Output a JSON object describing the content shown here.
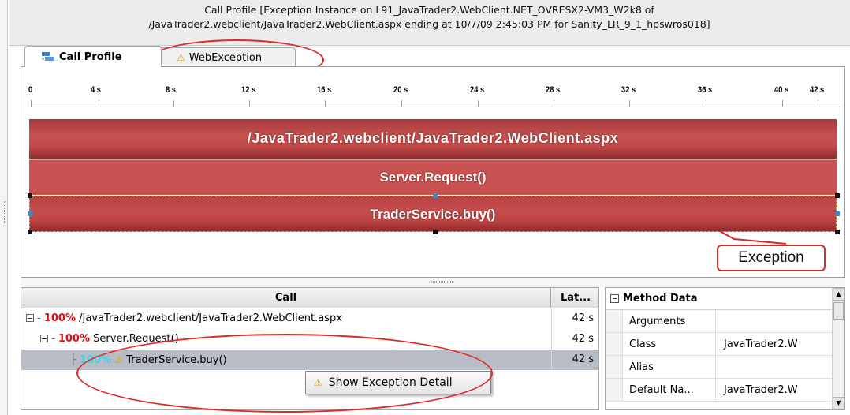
{
  "header": {
    "line1": "Call Profile [Exception Instance on L91_JavaTrader2.WebClient.NET_OVRESX2-VM3_W2k8 of",
    "line2": "/JavaTrader2.webclient/JavaTrader2.WebClient.aspx ending at 10/7/09 2:45:03 PM for Sanity_LR_9_1_hpswros018]"
  },
  "tabs": [
    {
      "label": "Call Profile",
      "icon": "call-profile-icon"
    },
    {
      "label": "WebException",
      "icon": "warning-icon"
    }
  ],
  "timeline": {
    "ticks": [
      "0",
      "4 s",
      "8 s",
      "12 s",
      "16 s",
      "20 s",
      "24 s",
      "28 s",
      "32 s",
      "36 s",
      "40 s",
      "42 s"
    ],
    "bars": [
      "/JavaTrader2.webclient/JavaTrader2.WebClient.aspx",
      "Server.Request()",
      "TraderService.buy()"
    ],
    "callout": "Exception"
  },
  "call_table": {
    "headers": {
      "call": "Call",
      "latency": "Lat..."
    },
    "rows": [
      {
        "pct": "100%",
        "name": "/JavaTrader2.webclient/JavaTrader2.WebClient.aspx",
        "latency": "42 s"
      },
      {
        "pct": "100%",
        "name": "Server.Request()",
        "latency": "42 s"
      },
      {
        "pct": "100%",
        "name": "TraderService.buy()",
        "latency": "42 s"
      }
    ],
    "context_menu": "Show Exception Detail"
  },
  "method_data": {
    "title": "Method Data",
    "rows": [
      {
        "name": "Arguments",
        "value": ""
      },
      {
        "name": "Class",
        "value": "JavaTrader2.W"
      },
      {
        "name": "Alias",
        "value": ""
      },
      {
        "name": "Default Na...",
        "value": "JavaTrader2.W"
      }
    ]
  },
  "colors": {
    "bar": "#c24949",
    "callout_ring": "#e02a2a",
    "percent": "#e01010",
    "percent_highlight": "#3fd6e8"
  }
}
